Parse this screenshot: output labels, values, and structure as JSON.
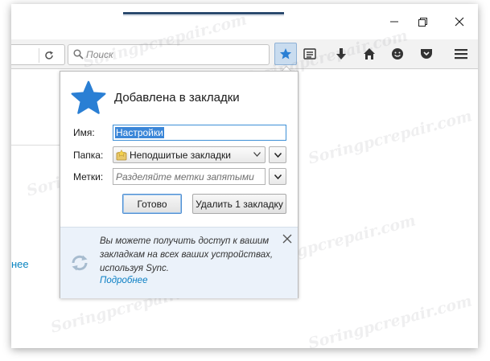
{
  "toolbar": {
    "search_placeholder": "Поиск"
  },
  "page": {
    "left_link_fragment": "нее"
  },
  "popup": {
    "title": "Добавлена в закладки",
    "name_label": "Имя:",
    "name_value": "Настройки",
    "folder_label": "Папка:",
    "folder_value": "Неподшитые закладки",
    "tags_label": "Метки:",
    "tags_placeholder": "Разделяйте метки запятыми",
    "done_button": "Готово",
    "remove_button": "Удалить 1 закладку",
    "sync_text": "Вы можете получить доступ к вашим закладкам на всех ваших устройствах, используя Sync.",
    "sync_link": "Подробнее"
  },
  "watermark": "Soringpcrepair.com",
  "colors": {
    "accent_blue": "#2a7fd4",
    "highlight": "#3a86d8",
    "footer_bg": "#ebf2fa",
    "link": "#0a7fc4"
  },
  "icons": {
    "minimize": "minimize-icon",
    "restore": "restore-icon",
    "close": "close-icon",
    "reload": "reload-icon",
    "search": "search-icon",
    "bookmark_star": "star-icon",
    "bookmarks_list": "bookmarks-list-icon",
    "downloads": "download-arrow-icon",
    "home": "home-icon",
    "chat": "chat-smile-icon",
    "pocket": "pocket-icon",
    "menu": "hamburger-menu-icon"
  }
}
